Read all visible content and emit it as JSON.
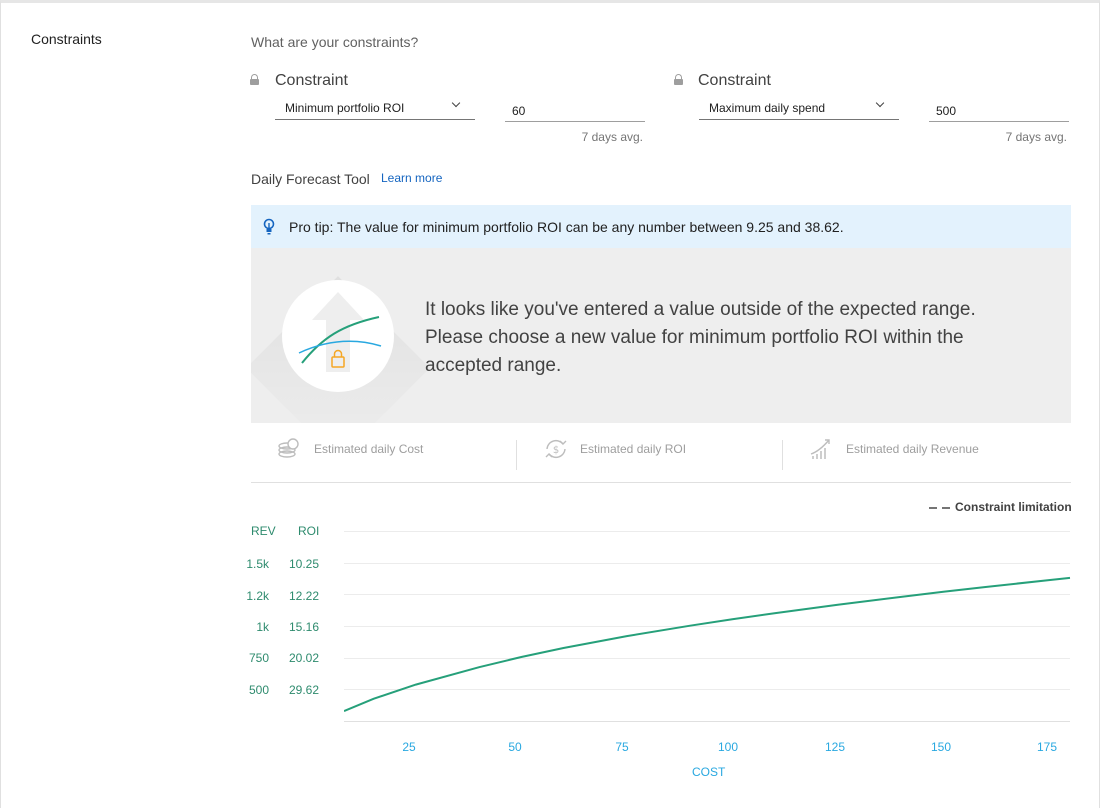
{
  "section": {
    "label": "Constraints",
    "question": "What are your constraints?"
  },
  "constraints": [
    {
      "title": "Constraint",
      "selected": "Minimum portfolio ROI",
      "value": "60",
      "hint": "7 days avg."
    },
    {
      "title": "Constraint",
      "selected": "Maximum daily spend",
      "value": "500",
      "hint": "7 days avg."
    }
  ],
  "forecast": {
    "title": "Daily Forecast Tool",
    "learn_more": "Learn more",
    "pro_tip": "Pro tip: The value for minimum portfolio ROI can be any number between 9.25 and 38.62.",
    "warning_lines": [
      "It looks like you've entered a value outside of the expected range.",
      "Please choose a new value for minimum portfolio ROI within the",
      "accepted range."
    ]
  },
  "metrics": [
    {
      "label": "Estimated daily Cost",
      "icon": "coins-icon"
    },
    {
      "label": "Estimated daily ROI",
      "icon": "dollar-cycle-icon"
    },
    {
      "label": "Estimated daily Revenue",
      "icon": "growth-chart-icon"
    }
  ],
  "colors": {
    "line": "#26a07a",
    "rev_roi_axis": "#2e8b6e",
    "cost_axis": "#29a8e0",
    "tip_bg": "#e3f2fd",
    "link": "#1565c0"
  },
  "chart_data": {
    "type": "line",
    "legend": "Constraint limitation",
    "legend_position": "top-right",
    "y_headers": [
      "REV",
      "ROI"
    ],
    "rev_ticks": [
      "1.5k",
      "1.2k",
      "1k",
      "750",
      "500"
    ],
    "roi_ticks": [
      "10.25",
      "12.22",
      "15.16",
      "20.02",
      "29.62"
    ],
    "x_ticks": [
      "25",
      "50",
      "75",
      "100",
      "125",
      "150",
      "175"
    ],
    "xlabel": "COST",
    "x_range": [
      8,
      180
    ],
    "rev_range": [
      250,
      1750
    ],
    "grid": true,
    "series": [
      {
        "x": [
          8,
          15,
          25,
          40,
          50,
          60,
          75,
          90,
          100,
          110,
          125,
          140,
          150,
          160,
          175,
          180
        ],
        "y": [
          328,
          425,
          537,
          675,
          755,
          826,
          920,
          1002,
          1053,
          1101,
          1167,
          1230,
          1270,
          1308,
          1362,
          1380
        ]
      }
    ]
  }
}
